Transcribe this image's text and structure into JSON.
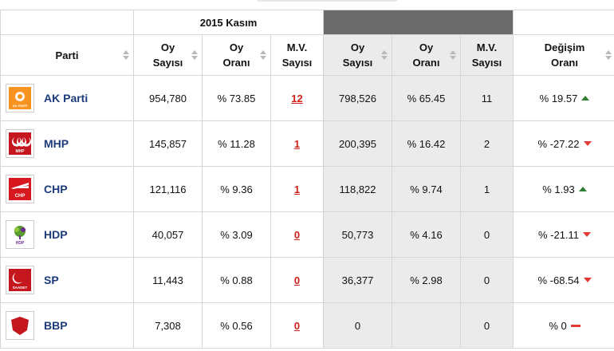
{
  "group_header": {
    "left": "2015 Kasım",
    "right": ""
  },
  "columns": {
    "party": "Parti",
    "votes_2015_line1": "Oy",
    "votes_2015_line2": "Sayısı",
    "rate_2015_line1": "Oy",
    "rate_2015_line2": "Oranı",
    "seats_2015_line1": "M.V.",
    "seats_2015_line2": "Sayısı",
    "votes_prev_line1": "Oy",
    "votes_prev_line2": "Sayısı",
    "rate_prev_line1": "Oy",
    "rate_prev_line2": "Oranı",
    "seats_prev_line1": "M.V.",
    "seats_prev_line2": "Sayısı",
    "change_line1": "Değişim",
    "change_line2": "Oranı"
  },
  "rows": [
    {
      "name": "AK Parti",
      "logo": "akp-logo",
      "votes": "954,780",
      "rate": "% 73.85",
      "seats": "12",
      "votes_prev": "798,526",
      "rate_prev": "% 65.45",
      "seats_prev": "11",
      "change": "% 19.57",
      "trend": "up"
    },
    {
      "name": "MHP",
      "logo": "mhp-logo",
      "votes": "145,857",
      "rate": "% 11.28",
      "seats": "1",
      "votes_prev": "200,395",
      "rate_prev": "% 16.42",
      "seats_prev": "2",
      "change": "% -27.22",
      "trend": "down"
    },
    {
      "name": "CHP",
      "logo": "chp-logo",
      "votes": "121,116",
      "rate": "% 9.36",
      "seats": "1",
      "votes_prev": "118,822",
      "rate_prev": "% 9.74",
      "seats_prev": "1",
      "change": "% 1.93",
      "trend": "up"
    },
    {
      "name": "HDP",
      "logo": "hdp-logo",
      "votes": "40,057",
      "rate": "% 3.09",
      "seats": "0",
      "votes_prev": "50,773",
      "rate_prev": "% 4.16",
      "seats_prev": "0",
      "change": "% -21.11",
      "trend": "down"
    },
    {
      "name": "SP",
      "logo": "sp-logo",
      "votes": "11,443",
      "rate": "% 0.88",
      "seats": "0",
      "votes_prev": "36,377",
      "rate_prev": "% 2.98",
      "seats_prev": "0",
      "change": "% -68.54",
      "trend": "down"
    },
    {
      "name": "BBP",
      "logo": "bbp-logo",
      "votes": "7,308",
      "rate": "% 0.56",
      "seats": "0",
      "votes_prev": "0",
      "rate_prev": "",
      "seats_prev": "0",
      "change": "% 0",
      "trend": "flat"
    }
  ],
  "logo_text": {
    "akp": "AK PARTİ",
    "mhp": "MHP",
    "chp": "CHP",
    "hdp": "HDP",
    "sp": "SAADET"
  },
  "colors": {
    "party_name": "#1d3a7a",
    "seat_link": "#d0201a",
    "trend_up": "#2e7d32",
    "trend_down": "#e53935",
    "prev_column_bg": "#ebebeb",
    "prev_header_bg": "#6b6b6b"
  }
}
